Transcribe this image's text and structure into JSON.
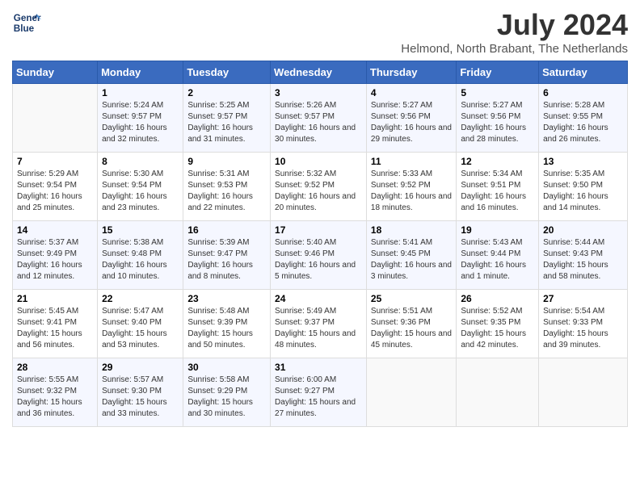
{
  "header": {
    "logo_line1": "General",
    "logo_line2": "Blue",
    "month_year": "July 2024",
    "location": "Helmond, North Brabant, The Netherlands"
  },
  "days_of_week": [
    "Sunday",
    "Monday",
    "Tuesday",
    "Wednesday",
    "Thursday",
    "Friday",
    "Saturday"
  ],
  "weeks": [
    [
      {
        "day": "",
        "sunrise": "",
        "sunset": "",
        "daylight": ""
      },
      {
        "day": "1",
        "sunrise": "Sunrise: 5:24 AM",
        "sunset": "Sunset: 9:57 PM",
        "daylight": "Daylight: 16 hours and 32 minutes."
      },
      {
        "day": "2",
        "sunrise": "Sunrise: 5:25 AM",
        "sunset": "Sunset: 9:57 PM",
        "daylight": "Daylight: 16 hours and 31 minutes."
      },
      {
        "day": "3",
        "sunrise": "Sunrise: 5:26 AM",
        "sunset": "Sunset: 9:57 PM",
        "daylight": "Daylight: 16 hours and 30 minutes."
      },
      {
        "day": "4",
        "sunrise": "Sunrise: 5:27 AM",
        "sunset": "Sunset: 9:56 PM",
        "daylight": "Daylight: 16 hours and 29 minutes."
      },
      {
        "day": "5",
        "sunrise": "Sunrise: 5:27 AM",
        "sunset": "Sunset: 9:56 PM",
        "daylight": "Daylight: 16 hours and 28 minutes."
      },
      {
        "day": "6",
        "sunrise": "Sunrise: 5:28 AM",
        "sunset": "Sunset: 9:55 PM",
        "daylight": "Daylight: 16 hours and 26 minutes."
      }
    ],
    [
      {
        "day": "7",
        "sunrise": "Sunrise: 5:29 AM",
        "sunset": "Sunset: 9:54 PM",
        "daylight": "Daylight: 16 hours and 25 minutes."
      },
      {
        "day": "8",
        "sunrise": "Sunrise: 5:30 AM",
        "sunset": "Sunset: 9:54 PM",
        "daylight": "Daylight: 16 hours and 23 minutes."
      },
      {
        "day": "9",
        "sunrise": "Sunrise: 5:31 AM",
        "sunset": "Sunset: 9:53 PM",
        "daylight": "Daylight: 16 hours and 22 minutes."
      },
      {
        "day": "10",
        "sunrise": "Sunrise: 5:32 AM",
        "sunset": "Sunset: 9:52 PM",
        "daylight": "Daylight: 16 hours and 20 minutes."
      },
      {
        "day": "11",
        "sunrise": "Sunrise: 5:33 AM",
        "sunset": "Sunset: 9:52 PM",
        "daylight": "Daylight: 16 hours and 18 minutes."
      },
      {
        "day": "12",
        "sunrise": "Sunrise: 5:34 AM",
        "sunset": "Sunset: 9:51 PM",
        "daylight": "Daylight: 16 hours and 16 minutes."
      },
      {
        "day": "13",
        "sunrise": "Sunrise: 5:35 AM",
        "sunset": "Sunset: 9:50 PM",
        "daylight": "Daylight: 16 hours and 14 minutes."
      }
    ],
    [
      {
        "day": "14",
        "sunrise": "Sunrise: 5:37 AM",
        "sunset": "Sunset: 9:49 PM",
        "daylight": "Daylight: 16 hours and 12 minutes."
      },
      {
        "day": "15",
        "sunrise": "Sunrise: 5:38 AM",
        "sunset": "Sunset: 9:48 PM",
        "daylight": "Daylight: 16 hours and 10 minutes."
      },
      {
        "day": "16",
        "sunrise": "Sunrise: 5:39 AM",
        "sunset": "Sunset: 9:47 PM",
        "daylight": "Daylight: 16 hours and 8 minutes."
      },
      {
        "day": "17",
        "sunrise": "Sunrise: 5:40 AM",
        "sunset": "Sunset: 9:46 PM",
        "daylight": "Daylight: 16 hours and 5 minutes."
      },
      {
        "day": "18",
        "sunrise": "Sunrise: 5:41 AM",
        "sunset": "Sunset: 9:45 PM",
        "daylight": "Daylight: 16 hours and 3 minutes."
      },
      {
        "day": "19",
        "sunrise": "Sunrise: 5:43 AM",
        "sunset": "Sunset: 9:44 PM",
        "daylight": "Daylight: 16 hours and 1 minute."
      },
      {
        "day": "20",
        "sunrise": "Sunrise: 5:44 AM",
        "sunset": "Sunset: 9:43 PM",
        "daylight": "Daylight: 15 hours and 58 minutes."
      }
    ],
    [
      {
        "day": "21",
        "sunrise": "Sunrise: 5:45 AM",
        "sunset": "Sunset: 9:41 PM",
        "daylight": "Daylight: 15 hours and 56 minutes."
      },
      {
        "day": "22",
        "sunrise": "Sunrise: 5:47 AM",
        "sunset": "Sunset: 9:40 PM",
        "daylight": "Daylight: 15 hours and 53 minutes."
      },
      {
        "day": "23",
        "sunrise": "Sunrise: 5:48 AM",
        "sunset": "Sunset: 9:39 PM",
        "daylight": "Daylight: 15 hours and 50 minutes."
      },
      {
        "day": "24",
        "sunrise": "Sunrise: 5:49 AM",
        "sunset": "Sunset: 9:37 PM",
        "daylight": "Daylight: 15 hours and 48 minutes."
      },
      {
        "day": "25",
        "sunrise": "Sunrise: 5:51 AM",
        "sunset": "Sunset: 9:36 PM",
        "daylight": "Daylight: 15 hours and 45 minutes."
      },
      {
        "day": "26",
        "sunrise": "Sunrise: 5:52 AM",
        "sunset": "Sunset: 9:35 PM",
        "daylight": "Daylight: 15 hours and 42 minutes."
      },
      {
        "day": "27",
        "sunrise": "Sunrise: 5:54 AM",
        "sunset": "Sunset: 9:33 PM",
        "daylight": "Daylight: 15 hours and 39 minutes."
      }
    ],
    [
      {
        "day": "28",
        "sunrise": "Sunrise: 5:55 AM",
        "sunset": "Sunset: 9:32 PM",
        "daylight": "Daylight: 15 hours and 36 minutes."
      },
      {
        "day": "29",
        "sunrise": "Sunrise: 5:57 AM",
        "sunset": "Sunset: 9:30 PM",
        "daylight": "Daylight: 15 hours and 33 minutes."
      },
      {
        "day": "30",
        "sunrise": "Sunrise: 5:58 AM",
        "sunset": "Sunset: 9:29 PM",
        "daylight": "Daylight: 15 hours and 30 minutes."
      },
      {
        "day": "31",
        "sunrise": "Sunrise: 6:00 AM",
        "sunset": "Sunset: 9:27 PM",
        "daylight": "Daylight: 15 hours and 27 minutes."
      },
      {
        "day": "",
        "sunrise": "",
        "sunset": "",
        "daylight": ""
      },
      {
        "day": "",
        "sunrise": "",
        "sunset": "",
        "daylight": ""
      },
      {
        "day": "",
        "sunrise": "",
        "sunset": "",
        "daylight": ""
      }
    ]
  ]
}
